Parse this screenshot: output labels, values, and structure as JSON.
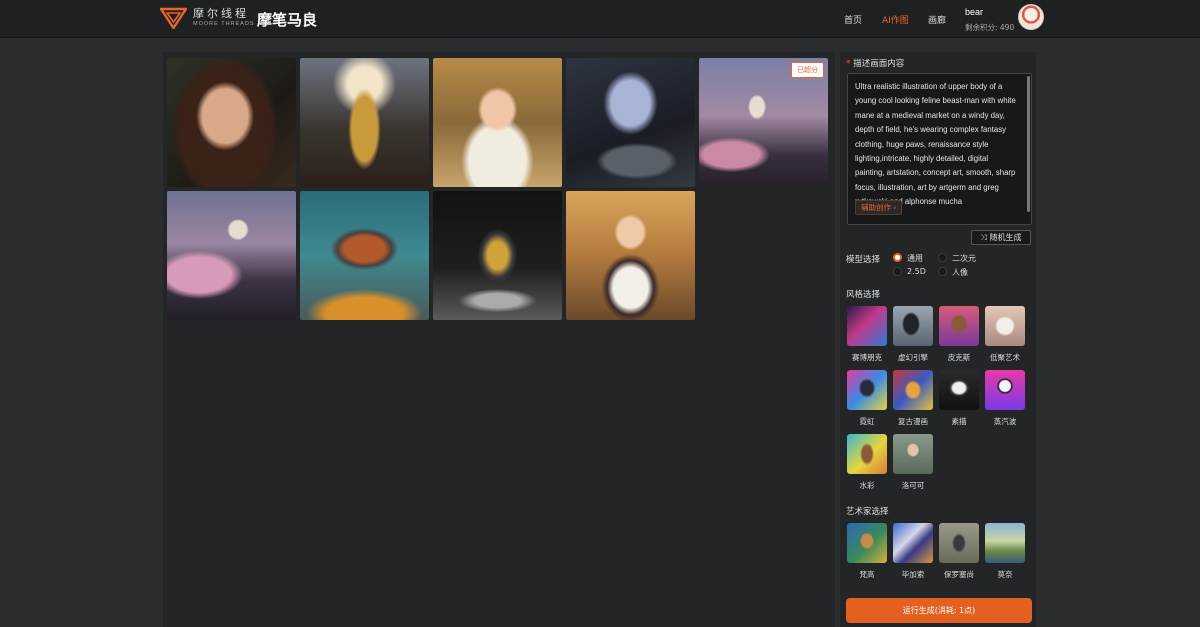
{
  "header": {
    "brand_cn": "摩尔线程",
    "brand_en": "MOORE THREADS",
    "app_title": "摩笔马良",
    "nav": [
      "首页",
      "AI作图",
      "画廊"
    ],
    "active_nav": "AI作图",
    "user_name": "bear",
    "credits": "剩余积分: 490",
    "accent_color": "#e8662a"
  },
  "gallery": {
    "images": [
      {
        "subject": "portrait of a brunette woman with braided hair"
      },
      {
        "subject": "golden armored feline knight in a medieval city"
      },
      {
        "subject": "blonde girl with cat ears in ornate white dress"
      },
      {
        "subject": "white-maned beast character leaning on a table"
      },
      {
        "subject": "pagoda on a hill with cherry blossoms at dusk",
        "badge": "已超分"
      },
      {
        "subject": "castle on a hill with pink cherry blossom trees"
      },
      {
        "subject": "floating mechanical airship over a teal valley"
      },
      {
        "subject": "robotic machine part on a dark pedestal"
      },
      {
        "subject": "anime girl in a dress under palm trees"
      }
    ]
  },
  "panel": {
    "prompt_label": "描述画面内容",
    "prompt_text": "Ultra realistic illustration of upper body of a young cool looking feline beast-man with white mane at a medieval market on a windy day, depth of field, he's wearing complex fantasy clothing, huge paws, renaissance style lighting,intricate, highly detailed, digital painting, artstation, concept art, smooth, sharp focus, illustration, art by artgerm and greg rutkowski and alphonse mucha",
    "assist_button": "辅助创作",
    "random_button": "随机生成",
    "model_label": "模型选择",
    "models": [
      {
        "label": "通用",
        "selected": true
      },
      {
        "label": "二次元",
        "selected": false
      },
      {
        "label": "2.5D",
        "selected": false
      },
      {
        "label": "人像",
        "selected": false
      }
    ],
    "style_label": "风格选择",
    "styles": [
      "赛博朋克",
      "虚幻引擎",
      "皮克斯",
      "低聚艺术",
      "霓虹",
      "复古漫画",
      "素描",
      "蒸汽波",
      "水彩",
      "洛可可"
    ],
    "artist_label": "艺术家选择",
    "artists": [
      "梵高",
      "毕加索",
      "保罗塞尚",
      "莫奈"
    ],
    "run_button": "运行生成(消耗: 1点)"
  }
}
